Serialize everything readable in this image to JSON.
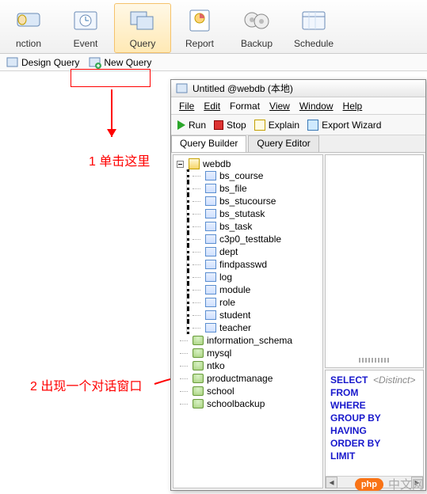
{
  "ribbon": [
    {
      "label": "nction"
    },
    {
      "label": "Event"
    },
    {
      "label": "Query",
      "selected": true
    },
    {
      "label": "Report"
    },
    {
      "label": "Backup"
    },
    {
      "label": "Schedule"
    }
  ],
  "subtoolbar": {
    "design": "Design Query",
    "newq": "New Query"
  },
  "dialog": {
    "title": "Untitled @webdb (本地)",
    "menu": [
      "File",
      "Edit",
      "Format",
      "View",
      "Window",
      "Help"
    ],
    "tools": {
      "run": "Run",
      "stop": "Stop",
      "explain": "Explain",
      "export": "Export Wizard"
    },
    "tabs": {
      "builder": "Query Builder",
      "editor": "Query Editor"
    },
    "tree": {
      "root": "webdb",
      "tables": [
        "bs_course",
        "bs_file",
        "bs_stucourse",
        "bs_stutask",
        "bs_task",
        "c3p0_testtable",
        "dept",
        "findpasswd",
        "log",
        "module",
        "role",
        "student",
        "teacher"
      ],
      "databases": [
        "information_schema",
        "mysql",
        "ntko",
        "productmanage",
        "school",
        "schoolbackup"
      ]
    },
    "sql": {
      "select": "SELECT",
      "distinct": "<Distinct>",
      "from": "FROM",
      "where": "WHERE",
      "groupby": "GROUP BY",
      "having": "HAVING",
      "orderby": "ORDER BY",
      "limit": "LIMIT"
    }
  },
  "annotations": {
    "a1": "1 单击这里",
    "a2": "2 出现一个对话窗口"
  },
  "watermark": {
    "brand": "php",
    "text": "中文网"
  }
}
